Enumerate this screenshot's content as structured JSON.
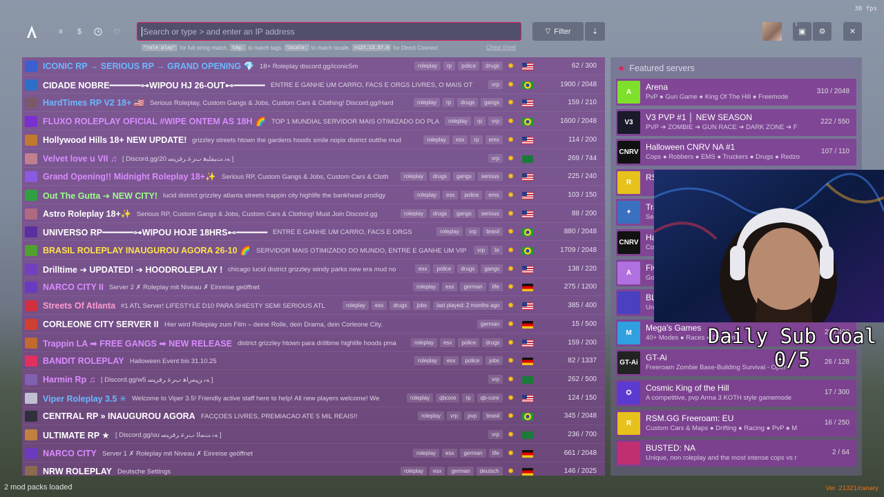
{
  "fps": "30 fps",
  "search": {
    "placeholder": "Search or type > and enter an IP address"
  },
  "hints": {
    "ex1": "\"role play\"",
    "t1": "for full string match,",
    "ex2": "tag:",
    "t2": "to match tags,",
    "ex3": "locale:",
    "t3": "to match locale,",
    "ex4": ">127.13.37.0",
    "t4": "for Direct Connect",
    "cheat": "Cheat sheet"
  },
  "toolbar": {
    "filter": "Filter",
    "notif_count": "1"
  },
  "servers": [
    {
      "name": "ICONIC RP → SERIOUS RP → GRAND OPENING 💎",
      "desc": "18+ Roleplay discord.gg/iconic5m",
      "tags": [
        "roleplay",
        "rp",
        "police",
        "drugs"
      ],
      "flag": "us",
      "players": "62 / 300",
      "color": "#6ab8ff",
      "icon": "#3b5fd0"
    },
    {
      "name": "CIDADE NOBRE━━━━━━⊶WIPOU HJ 26-OUT⊷━━━━━━",
      "desc": "ENTRE E GANHE UM CARRO, FACS E ORGS LIVRES, O MAIS OT",
      "tags": [
        "vrp"
      ],
      "flag": "br",
      "players": "1900 / 2048",
      "color": "#ffffff",
      "icon": "#2c6fc8"
    },
    {
      "name": "HardTimes RP V2 18+ 🇺🇸",
      "desc": "Serious Roleplay, Custom Gangs & Jobs, Custom Cars & Clothing! Discord.gg/Hard",
      "tags": [
        "roleplay",
        "rp",
        "drugs",
        "gangs"
      ],
      "flag": "us",
      "players": "159 / 210",
      "color": "#6ab8ff",
      "icon": "#7a5a6a"
    },
    {
      "name": "FLUXO ROLEPLAY OFICIAL #WIPE ONTEM AS 18H 🌈",
      "desc": "TOP 1 MUNDIAL SERVIDOR MAIS OTIMIZADO DO PLANETA",
      "tags": [
        "roleplay",
        "rp",
        "vrp"
      ],
      "flag": "br",
      "players": "1600 / 2048",
      "color": "#d98cff",
      "icon": "#7a2fd0"
    },
    {
      "name": "Hollywood Hills 18+ NEW UPDATE!",
      "desc": "grizzley streets htown the gardens hoods smile nopix district outthe mud",
      "tags": [
        "roleplay",
        "esx",
        "rp",
        "ems"
      ],
      "flag": "us",
      "players": "114 / 200",
      "color": "#ffffff",
      "icon": "#c07a30"
    },
    {
      "name": "Velvet love u VII ♫",
      "desc": "[ Discord.gg/20 ﻪﻧ ﺖﻴﻔﻠﻴﻫ ﺏﺮﻋ ﺮﻓﺮﻴﺳ ]",
      "tags": [
        "vrp"
      ],
      "flag": "sa",
      "players": "269 / 744",
      "color": "#d98cff",
      "icon": "#c08090"
    },
    {
      "name": "Grand Opening!! Midnight Roleplay 18+✨",
      "desc": "Serious RP, Custom Gangs & Jobs, Custom Cars & Cloth",
      "tags": [
        "roleplay",
        "drugs",
        "gangs",
        "serious"
      ],
      "flag": "us",
      "players": "225 / 240",
      "color": "#d98cff",
      "icon": "#8a5ae0"
    },
    {
      "name": "Out The Gutta ➔ NEW CITY!",
      "desc": "lucid district grizzley atlanta streets trappin city highlife the bankhead prodigy",
      "tags": [
        "roleplay",
        "esx",
        "police",
        "ems"
      ],
      "flag": "us",
      "players": "103 / 150",
      "color": "#9bff8a",
      "icon": "#30a040"
    },
    {
      "name": "Astro Roleplay 18+✨",
      "desc": "Serious RP, Custom Gangs & Jobs, Custom Cars & Clothing! Must Join Discord.gg",
      "tags": [
        "roleplay",
        "drugs",
        "gangs",
        "serious"
      ],
      "flag": "us",
      "players": "88 / 200",
      "color": "#ffffff",
      "icon": "#b06a80"
    },
    {
      "name": "UNIVERSO RP━━━━━━⊶WIPOU HOJE 18HRS⊷━━━━━━",
      "desc": "ENTRE E GANHE UM CARRO, FACS E ORGS",
      "tags": [
        "roleplay",
        "vrp",
        "brasil"
      ],
      "flag": "br",
      "players": "880 / 2048",
      "color": "#ffffff",
      "icon": "#5a2fa0"
    },
    {
      "name": "BRASIL ROLEPLAY INAUGUROU AGORA 26-10 🌈",
      "desc": "SERVIDOR MAIS OTIMIZADO DO MUNDO, ENTRE E GANHE UM VIP",
      "tags": [
        "vrp",
        "br"
      ],
      "flag": "br",
      "players": "1709 / 2048",
      "color": "#ffe24a",
      "icon": "#50a030"
    },
    {
      "name": "Drilltime ➔ UPDATED! ➔ HOODROLEPLAY !",
      "desc": "chicago lucid district grizzley windy parks new era mud no",
      "tags": [
        "esx",
        "police",
        "drugs",
        "gangs"
      ],
      "flag": "us",
      "players": "138 / 220",
      "color": "#ffffff",
      "icon": "#7040c0"
    },
    {
      "name": "NARCO CITY II",
      "desc": "Server 2 ✗ Roleplay mit Niveau ✗ Einreise geöffnet",
      "tags": [
        "roleplay",
        "esx",
        "german",
        "life"
      ],
      "flag": "de",
      "players": "275 / 1200",
      "color": "#d98cff",
      "icon": "#6a3ac0"
    },
    {
      "name": "Streets Of Atlanta",
      "desc": "#1 ATL Server! LIFESTYLE D10 PARA SHIESTY SEMI SERIOUS ATL",
      "tags": [
        "roleplay",
        "esx",
        "drugs",
        "jobs",
        "last played: 2 months ago"
      ],
      "flag": "us",
      "players": "385 / 400",
      "color": "#ff9ad0",
      "icon": "#d03040"
    },
    {
      "name": "CORLEONE CITY SERVER II",
      "desc": "Hier wird Roleplay zum Film – deine Rolle, dein Drama, dein Corleone City.",
      "tags": [
        "german"
      ],
      "flag": "de",
      "players": "15 / 500",
      "color": "#ffffff",
      "icon": "#d04030"
    },
    {
      "name": "Trappin LA ➡ FREE GANGS ➡ NEW RELEASE",
      "desc": "district grizzley htown para drilltime highlife hoods pma",
      "tags": [
        "roleplay",
        "esx",
        "police",
        "drugs"
      ],
      "flag": "us",
      "players": "159 / 200",
      "color": "#d98cff",
      "icon": "#c06a30"
    },
    {
      "name": "BANDIT ROLEPLAY",
      "desc": "Halloween Event bis 31.10.25",
      "tags": [
        "roleplay",
        "esx",
        "police",
        "jobs"
      ],
      "flag": "de",
      "players": "82 / 1337",
      "color": "#d98cff",
      "icon": "#e03060"
    },
    {
      "name": "Harmin Rp ♫",
      "desc": "[ Discord.gg/w5 ﻪﻧ ﻦﻴﻣﺭﺎﻫ ﺏﺮﻋ ﺮﻓﺮﻴﺳ ]",
      "tags": [
        "vrp"
      ],
      "flag": "sa",
      "players": "262 / 500",
      "color": "#d98cff",
      "icon": "#8060b0"
    },
    {
      "name": "Viper Roleplay 3.5 ✳",
      "desc": "Welcome to Viper 3.5! Friendly active staff here to help! All new players welcome! We",
      "tags": [
        "roleplay",
        "qbcore",
        "rp",
        "qb-core"
      ],
      "flag": "us",
      "players": "124 / 150",
      "color": "#6ab8ff",
      "icon": "#c0c0d0"
    },
    {
      "name": "CENTRAL RP » INAUGUROU AGORA",
      "desc": "FACÇOES LIVRES, PREMIACAO ATE 5 MIL REAIS!!",
      "tags": [
        "roleplay",
        "vrp",
        "pvp",
        "brasil"
      ],
      "flag": "br",
      "players": "345 / 2048",
      "color": "#ffffff",
      "icon": "#30303a"
    },
    {
      "name": "ULTIMATE RP ★",
      "desc": "[ Discord.gg/uu ﻪﻧ ﺖﻤﻟﺍ ﺏﺮﻋ ﺮﻓﺮﻴﺳ ]",
      "tags": [
        "vrp"
      ],
      "flag": "sa",
      "players": "236 / 700",
      "color": "#ffffff",
      "icon": "#c08040"
    },
    {
      "name": "NARCO CITY",
      "desc": "Server 1 ✗ Roleplay mit Niveau ✗ Einreise geöffnet",
      "tags": [
        "roleplay",
        "esx",
        "german",
        "life"
      ],
      "flag": "de",
      "players": "661 / 2048",
      "color": "#d98cff",
      "icon": "#6a3ac0"
    },
    {
      "name": "NRW ROLEPLAY",
      "desc": "Deutsche Settings",
      "tags": [
        "roleplay",
        "esx",
        "german",
        "deutsch"
      ],
      "flag": "de",
      "players": "146 / 2025",
      "color": "#ffffff",
      "icon": "#8a6a50"
    }
  ],
  "featured": {
    "title": "Featured servers",
    "items": [
      {
        "name": "Arena",
        "desc": "PvP ● Gun Game ● King Of The Hill ● Freemode",
        "players": "310 / 2048",
        "icon_text": "A",
        "icon_bg": "#7ee02a"
      },
      {
        "name": "V3 PVP #1 │ NEW SEASON",
        "desc": "PVP ➔ ZOMBIE ➔ GUN RACE ➔ DARK ZONE ➔ F",
        "players": "222 / 550",
        "icon_text": "V3",
        "icon_bg": "#1a1a2a"
      },
      {
        "name": "Halloween CNRV NA #1",
        "desc": "Cops ● Robbers ● EMS ● Truckers ● Drugs ● Redzo",
        "players": "107 / 110",
        "icon_text": "CNRV",
        "icon_bg": "#111"
      },
      {
        "name": "RSM",
        "desc": "",
        "players": "",
        "icon_text": "R",
        "icon_bg": "#e6c21a"
      },
      {
        "name": "Tra",
        "desc": "Ser",
        "players": "",
        "icon_text": "✦",
        "icon_bg": "#3a70c0"
      },
      {
        "name": "Ha",
        "desc": "Co",
        "players": "",
        "icon_text": "CNRV",
        "icon_bg": "#111"
      },
      {
        "name": "Fiv",
        "desc": "Go",
        "players": "",
        "icon_text": "A",
        "icon_bg": "#b070e0"
      },
      {
        "name": "BL",
        "desc": "Un",
        "players": "",
        "icon_text": "",
        "icon_bg": "#4a40c0"
      },
      {
        "name": "Mega's Games",
        "desc": "40+ Modes ● Races ● Deathm",
        "players": "28 / 400",
        "icon_text": "M",
        "icon_bg": "#30a0e0"
      },
      {
        "name": "GT-Ai",
        "desc": "Freeroam Zombie Base-Building Survival - Open",
        "players": "26 / 128",
        "icon_text": "GT-Ai",
        "icon_bg": "#222"
      },
      {
        "name": "Cosmic King of the Hill",
        "desc": "A competitive, pvp Arma 3 KOTH style gamemode",
        "players": "17 / 300",
        "icon_text": "✪",
        "icon_bg": "#5a3ad0"
      },
      {
        "name": "RSM.GG Freeroam: EU",
        "desc": "Custom Cars & Maps ● Drifting ● Racing ● PvP ● M",
        "players": "16 / 250",
        "icon_text": "R",
        "icon_bg": "#e6c21a"
      },
      {
        "name": "BUSTED: NA",
        "desc": "Unique, non roleplay and the most intense cops vs r",
        "players": "2 / 64",
        "icon_text": "",
        "icon_bg": "#c03070"
      }
    ]
  },
  "overlay": {
    "goal_title": "Daily Sub Goal",
    "goal_value": "0/5"
  },
  "footer": {
    "modpacks": "2 mod packs loaded",
    "version": "Ver. 21321/canary"
  },
  "colors": {
    "accent": "#e0205a",
    "list_bg": "#7a468c",
    "sun": "#f7c21b",
    "version": "#e8741f"
  }
}
